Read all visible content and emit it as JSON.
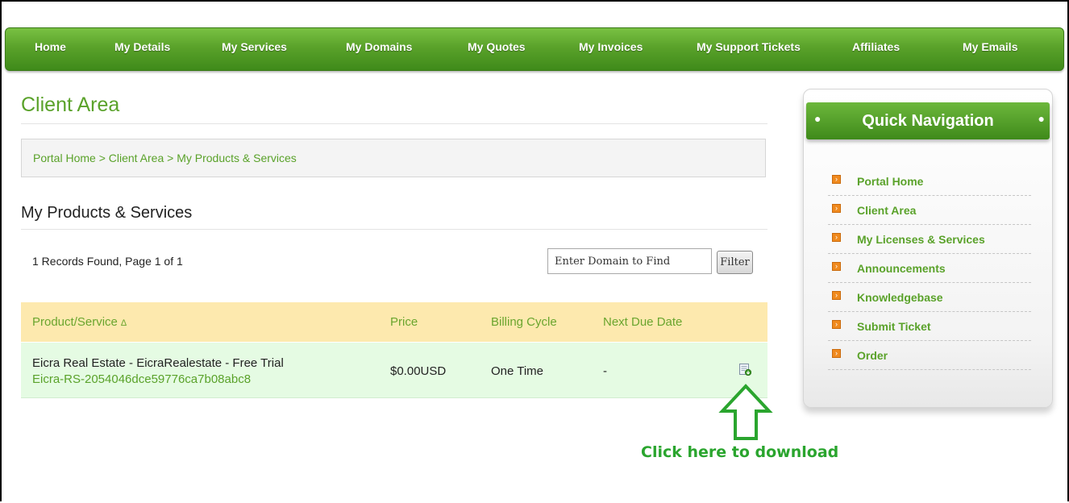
{
  "nav": {
    "items": [
      "Home",
      "My Details",
      "My Services",
      "My Domains",
      "My Quotes",
      "My Invoices",
      "My Support Tickets",
      "Affiliates",
      "My Emails"
    ]
  },
  "main": {
    "title": "Client Area",
    "breadcrumb": {
      "text": "Portal Home > Client Area > My Products & Services"
    },
    "section_title": "My Products & Services",
    "records_text": "1 Records Found, Page 1 of 1",
    "search": {
      "value": "Enter Domain to Find"
    },
    "filter_label": "Filter",
    "table": {
      "columns": [
        "Product/Service",
        "Price",
        "Billing Cycle",
        "Next Due Date"
      ],
      "sort_indicator": "∆",
      "rows": [
        {
          "product": "Eicra Real Estate - EicraRealestate - Free Trial",
          "license": "Eicra-RS-2054046dce59776ca7b08abc8",
          "price": "$0.00USD",
          "billing_cycle": "One Time",
          "next_due": "-"
        }
      ]
    },
    "download_caption": "Click here to download"
  },
  "sidebar": {
    "title": "Quick Navigation",
    "items": [
      "Portal Home",
      "Client Area",
      "My Licenses & Services",
      "Announcements",
      "Knowledgebase",
      "Submit Ticket",
      "Order"
    ]
  },
  "colors": {
    "brand_green": "#5aa22a",
    "nav_gradient_top": "#79c143",
    "nav_gradient_bottom": "#3f8a1a",
    "table_header_bg": "#fde9ae",
    "table_row_bg": "#e5fbe3",
    "bullet_orange": "#f08a1e",
    "annotation_green": "#2aa52e"
  },
  "icons": {
    "sort": "sort-up-icon",
    "download": "download-icon",
    "annotation_arrow": "up-arrow-icon",
    "sidebar_bullet": "orange-arrow-bullet-icon"
  }
}
